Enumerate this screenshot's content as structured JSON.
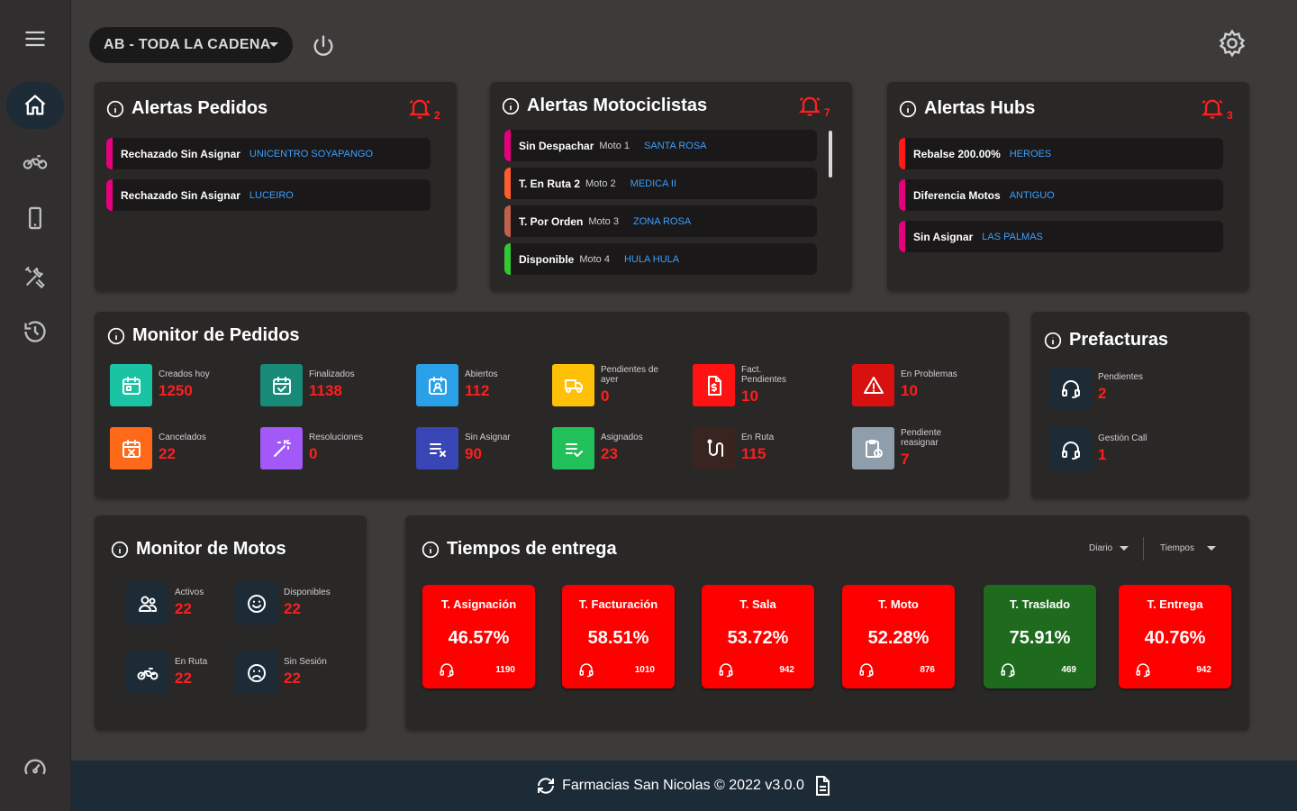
{
  "topbar": {
    "store_selector": "AB - TODA LA CADENA"
  },
  "alertas_pedidos": {
    "title": "Alertas Pedidos",
    "count": "2",
    "items": [
      {
        "status": "Rechazado Sin Asignar",
        "place": "UNICENTRO SOYAPANGO",
        "color": "#e6007e"
      },
      {
        "status": "Rechazado Sin Asignar",
        "place": "LUCEIRO",
        "color": "#e6007e"
      }
    ]
  },
  "alertas_motociclistas": {
    "title": "Alertas Motociclistas",
    "count": "7",
    "items": [
      {
        "status": "Sin Despachar",
        "moto": "Moto 1",
        "place": "SANTA ROSA",
        "color": "#e6007e"
      },
      {
        "status": "T. En Ruta 2",
        "moto": "Moto 2",
        "place": "MEDICA II",
        "color": "#ff5b2e"
      },
      {
        "status": "T. Por Orden",
        "moto": "Moto 3",
        "place": "ZONA ROSA",
        "color": "#c06048"
      },
      {
        "status": "Disponible",
        "moto": "Moto 4",
        "place": "HULA HULA",
        "color": "#32c832"
      }
    ]
  },
  "alertas_hubs": {
    "title": "Alertas Hubs",
    "count": "3",
    "items": [
      {
        "status": "Rebalse 200.00%",
        "place": "HEROES",
        "color": "#ff1a1a"
      },
      {
        "status": "Diferencia Motos",
        "place": "ANTIGUO",
        "color": "#e6007e"
      },
      {
        "status": "Sin Asignar",
        "place": "LAS PALMAS",
        "color": "#e6007e"
      }
    ]
  },
  "monitor_pedidos": {
    "title": "Monitor de Pedidos",
    "tiles": [
      {
        "label": "Creados hoy",
        "value": "1250",
        "color": "#19c3a3",
        "icon": "calendar-icon"
      },
      {
        "label": "Finalizados",
        "value": "1138",
        "color": "#178b77",
        "icon": "calendar-check-icon"
      },
      {
        "label": "Abiertos",
        "value": "112",
        "color": "#2aa0e8",
        "icon": "calendar-user-icon"
      },
      {
        "label": "Pendientes de ayer",
        "value": "0",
        "color": "#ffc107",
        "icon": "truck-clock-icon"
      },
      {
        "label": "Fact. Pendientes",
        "value": "10",
        "color": "#ff1212",
        "icon": "invoice-icon"
      },
      {
        "label": "En Problemas",
        "value": "10",
        "color": "#d71010",
        "icon": "warning-icon"
      },
      {
        "label": "Cancelados",
        "value": "22",
        "color": "#ff6a1a",
        "icon": "calendar-x-icon"
      },
      {
        "label": "Resoluciones",
        "value": "0",
        "color": "#a259f7",
        "icon": "magic-wand-icon"
      },
      {
        "label": "Sin Asignar",
        "value": "90",
        "color": "#3946b5",
        "icon": "list-x-icon"
      },
      {
        "label": "Asignados",
        "value": "23",
        "color": "#22c05a",
        "icon": "list-check-icon"
      },
      {
        "label": "En Ruta",
        "value": "115",
        "color": "#3a2420",
        "icon": "route-icon"
      },
      {
        "label": "Pendiente reasignar",
        "value": "7",
        "color": "#8f9eaa",
        "icon": "clipboard-clock-icon"
      }
    ]
  },
  "prefacturas": {
    "title": "Prefacturas",
    "tiles": [
      {
        "label": "Pendientes",
        "value": "2",
        "color": "#1c2b36",
        "icon": "headset-icon"
      },
      {
        "label": "Gestión Call",
        "value": "1",
        "color": "#1c2b36",
        "icon": "headset-icon"
      }
    ]
  },
  "monitor_motos": {
    "title": "Monitor de Motos",
    "tiles": [
      {
        "label": "Activos",
        "value": "22",
        "color": "#1c2b36",
        "icon": "users-icon"
      },
      {
        "label": "Disponibles",
        "value": "22",
        "color": "#1c2b36",
        "icon": "smile-icon"
      },
      {
        "label": "En Ruta",
        "value": "22",
        "color": "#1c2b36",
        "icon": "motorcycle-icon"
      },
      {
        "label": "Sin Sesión",
        "value": "22",
        "color": "#1c2b36",
        "icon": "sad-icon"
      }
    ]
  },
  "tiempos": {
    "title": "Tiempos de entrega",
    "period": "Diario",
    "metric": "Tiempos",
    "cards": [
      {
        "title": "T. Asignación",
        "percent": "46.57%",
        "count": "1190",
        "color": "#ff0000"
      },
      {
        "title": "T. Facturación",
        "percent": "58.51%",
        "count": "1010",
        "color": "#ff0000"
      },
      {
        "title": "T. Sala",
        "percent": "53.72%",
        "count": "942",
        "color": "#ff0000"
      },
      {
        "title": "T. Moto",
        "percent": "52.28%",
        "count": "876",
        "color": "#ff0000"
      },
      {
        "title": "T. Traslado",
        "percent": "75.91%",
        "count": "469",
        "color": "#1f6b1e"
      },
      {
        "title": "T. Entrega",
        "percent": "40.76%",
        "count": "942",
        "color": "#ff0000"
      }
    ]
  },
  "footer": {
    "text": "Farmacias San Nicolas © 2022 v3.0.0"
  }
}
